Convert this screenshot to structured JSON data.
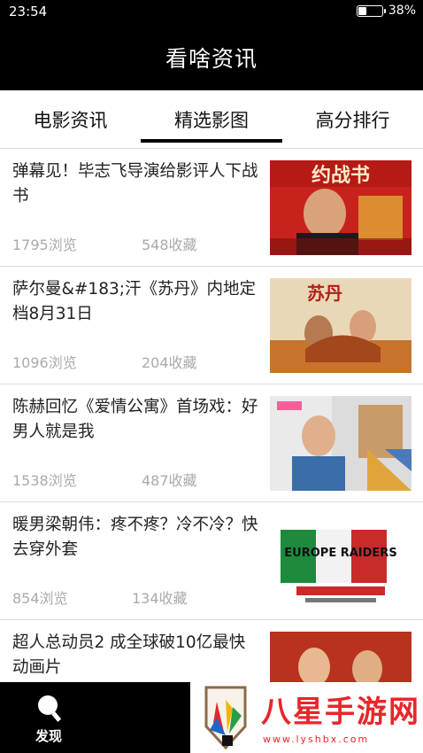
{
  "status": {
    "time": "23:54",
    "battery": "38%",
    "battery_level": 0.38
  },
  "header": {
    "title": "看啥资讯"
  },
  "tabs": [
    {
      "label": "电影资讯"
    },
    {
      "label": "精选影图"
    },
    {
      "label": "高分排行"
    }
  ],
  "active_tab": "精选影图",
  "items": [
    {
      "title": "弹幕见！毕志飞导演给影评人下战书",
      "views": "1795浏览",
      "favs": "548收藏",
      "thumb_text": "约战书"
    },
    {
      "title": "萨尔曼&#183;汗《苏丹》内地定档8月31日",
      "views": "1096浏览",
      "favs": "204收藏",
      "thumb_text": "苏丹"
    },
    {
      "title": "陈赫回忆《爱情公寓》首场戏：好男人就是我",
      "views": "1538浏览",
      "favs": "487收藏",
      "thumb_text": ""
    },
    {
      "title": "暖男梁朝伟：疼不疼？冷不冷？快去穿外套",
      "views": "854浏览",
      "favs": "134收藏",
      "thumb_text": "EUROPE RAIDERS"
    },
    {
      "title": "超人总动员2 成全球破10亿最快动画片",
      "views": "",
      "favs": "",
      "thumb_text": ""
    }
  ],
  "bottom_nav": {
    "discover_label": "发现"
  },
  "watermark": {
    "text": "八星手游网",
    "url": "www.lyshbx.com"
  }
}
